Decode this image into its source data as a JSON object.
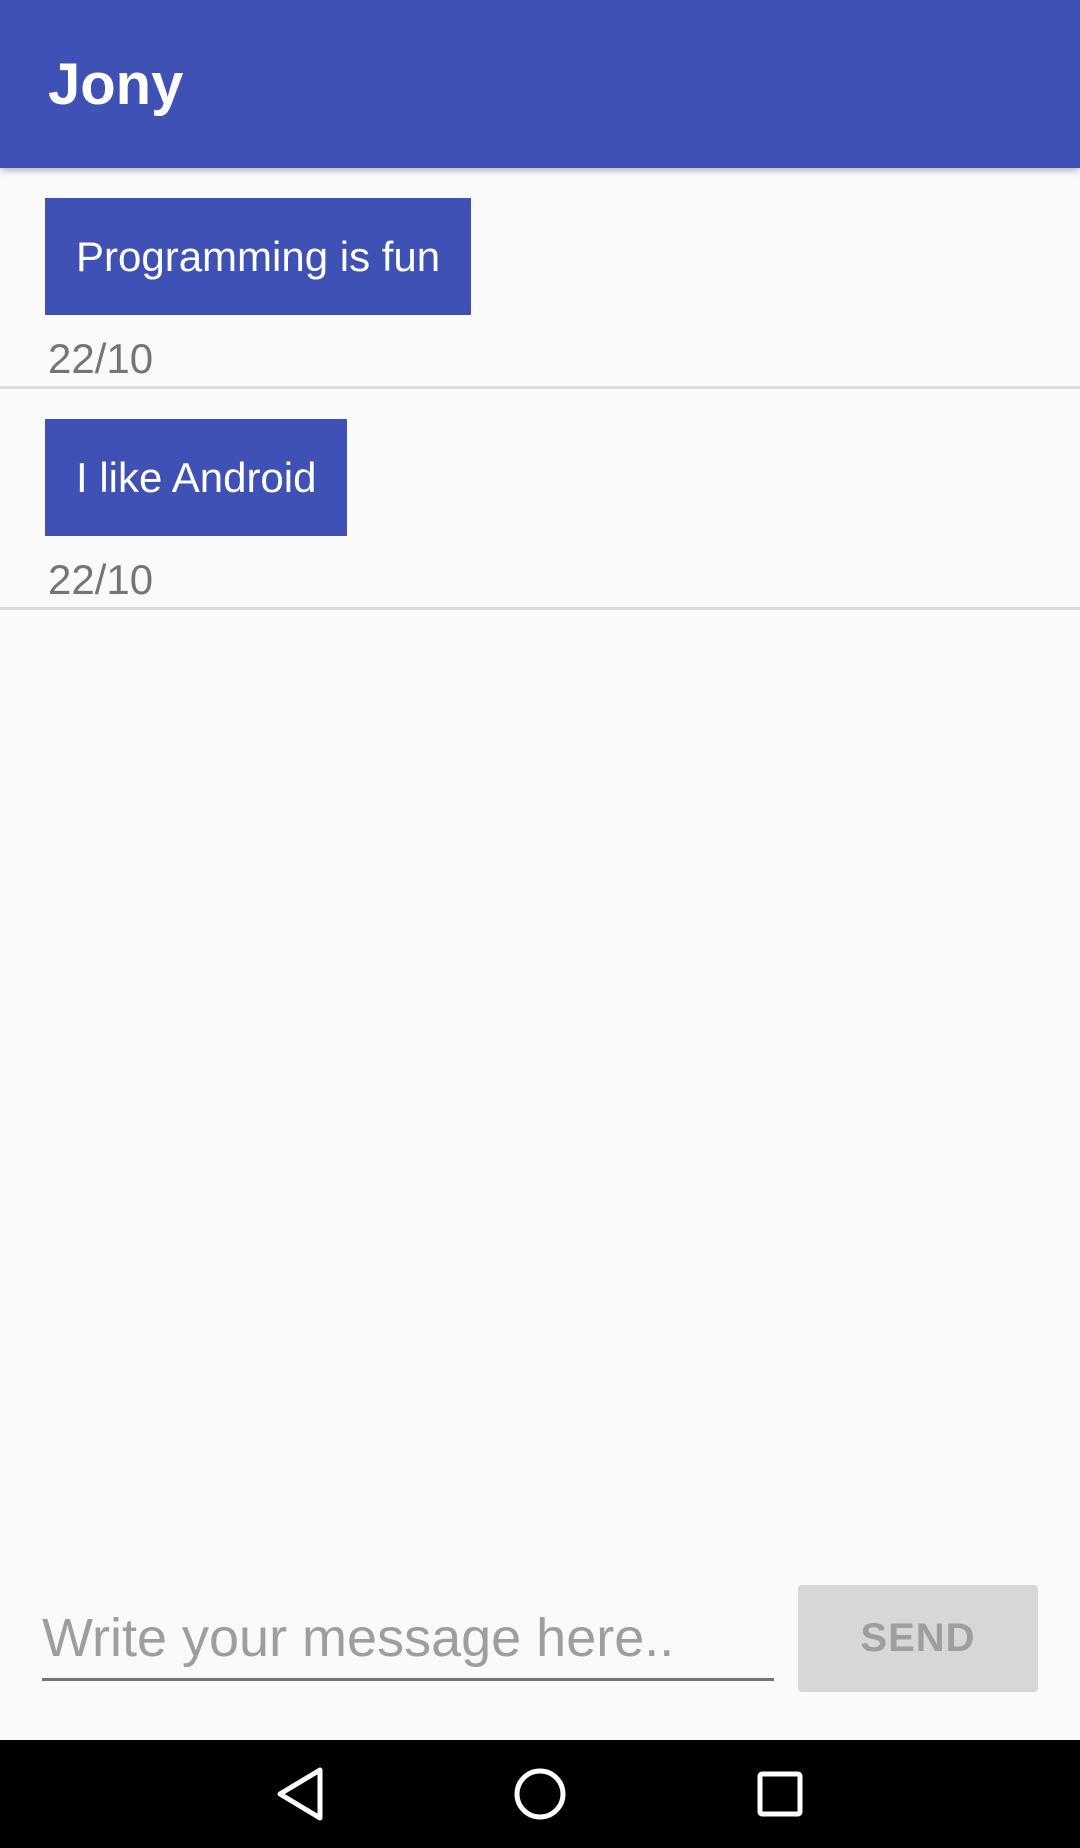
{
  "app_bar": {
    "title": "Jony",
    "color": "#3f51b5"
  },
  "messages": [
    {
      "text": "Programming is fun",
      "date": "22/10"
    },
    {
      "text": "I like Android",
      "date": "22/10"
    }
  ],
  "composer": {
    "placeholder": "Write your message here..",
    "value": "",
    "send_label": "SEND"
  },
  "nav_bar": {
    "buttons": [
      "back-icon",
      "home-icon",
      "recents-icon"
    ]
  }
}
